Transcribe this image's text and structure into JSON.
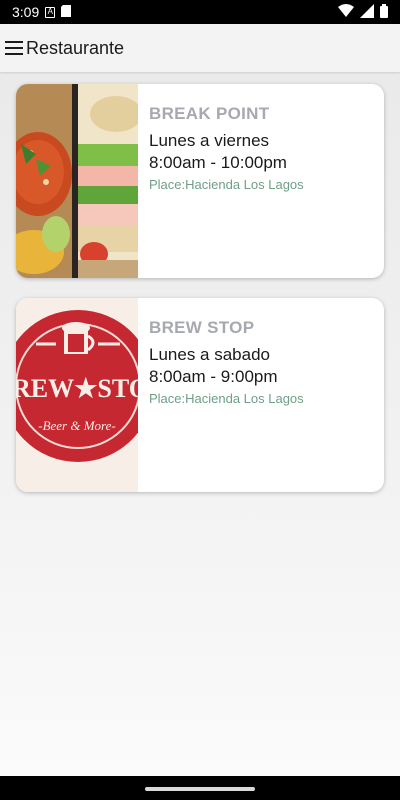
{
  "status_bar": {
    "time": "3:09",
    "icons": [
      "notification-a-icon",
      "sd-card-icon",
      "wifi-icon",
      "signal-icon",
      "battery-icon"
    ]
  },
  "app_bar": {
    "title": "Restaurante",
    "menu_icon": "hamburger-menu-icon"
  },
  "restaurants": [
    {
      "name": "BREAK POINT",
      "days": "Lunes a viernes",
      "hours": "8:00am - 10:00pm",
      "place": "Place:Hacienda Los Lagos",
      "image": "food-photo"
    },
    {
      "name": "BREW STOP",
      "days": "Lunes a sabado",
      "hours": "8:00am - 9:00pm",
      "place": "Place:Hacienda Los Lagos",
      "image": "brew-stop-logo",
      "logo_text": "REW★STO",
      "logo_tagline": "-Beer & More-"
    }
  ],
  "colors": {
    "name_gray": "#a7a9b0",
    "place_green": "#6e9f86",
    "logo_red": "#c62832"
  }
}
